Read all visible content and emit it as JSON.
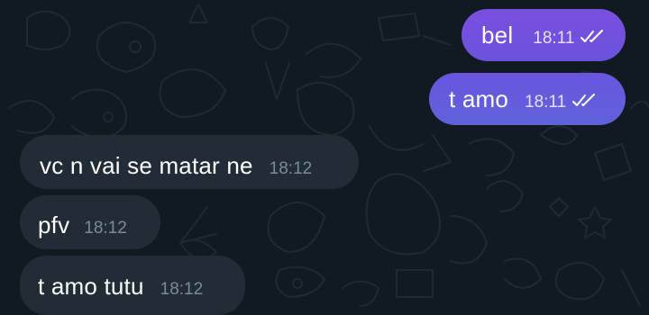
{
  "chat": {
    "messages": [
      {
        "direction": "outgoing",
        "text": "bel",
        "time": "18:11",
        "status_icon": "double-check-icon"
      },
      {
        "direction": "outgoing",
        "text": "t amo",
        "time": "18:11",
        "status_icon": "double-check-icon"
      },
      {
        "direction": "incoming",
        "text": "vc n vai se matar ne",
        "time": "18:12"
      },
      {
        "direction": "incoming",
        "text": "pfv",
        "time": "18:12"
      },
      {
        "direction": "incoming",
        "text": "t amo tutu",
        "time": "18:12"
      }
    ]
  },
  "colors": {
    "background": "#111a21",
    "outgoing_bubble": "#6a52dc",
    "incoming_bubble": "#222c36",
    "incoming_time": "#7d8a96"
  }
}
